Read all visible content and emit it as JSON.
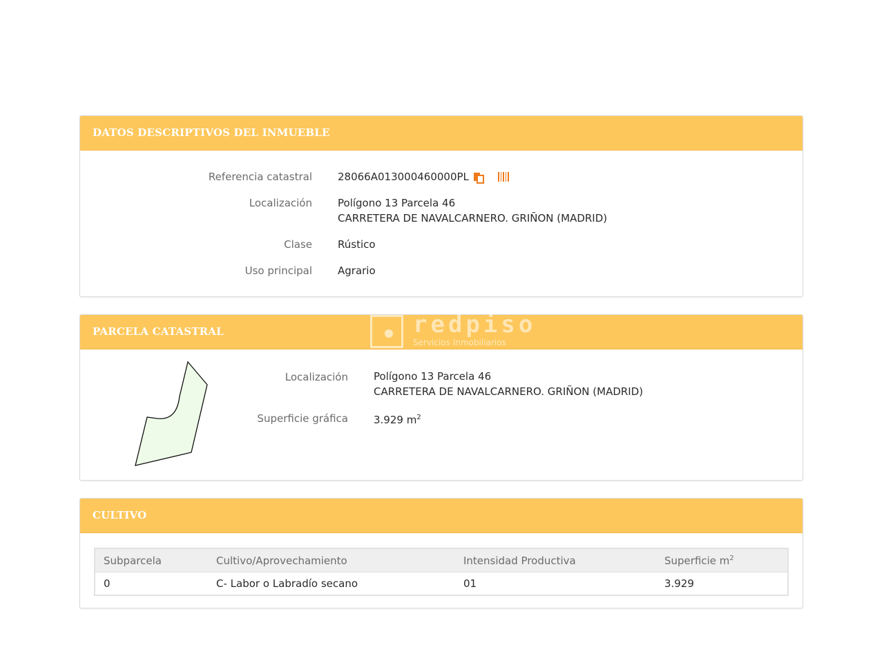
{
  "section1": {
    "title": "DATOS DESCRIPTIVOS DEL INMUEBLE",
    "ref_label": "Referencia catastral",
    "ref_value": "28066A013000460000PL",
    "loc_label": "Localización",
    "loc_line1": "Polígono 13 Parcela 46",
    "loc_line2": "CARRETERA DE NAVALCARNERO. GRIÑON (MADRID)",
    "clase_label": "Clase",
    "clase_value": "Rústico",
    "uso_label": "Uso principal",
    "uso_value": "Agrario"
  },
  "section2": {
    "title": "PARCELA CATASTRAL",
    "loc_label": "Localización",
    "loc_line1": "Polígono 13 Parcela 46",
    "loc_line2": "CARRETERA DE NAVALCARNERO. GRIÑON (MADRID)",
    "sup_label": "Superficie gráfica",
    "sup_value": "3.929 m",
    "sup_exp": "2"
  },
  "section3": {
    "title": "CULTIVO",
    "headers": {
      "subparcela": "Subparcela",
      "cultivo": "Cultivo/Aprovechamiento",
      "intensidad": "Intensidad Productiva",
      "superficie": "Superficie m",
      "superficie_exp": "2"
    },
    "rows": [
      {
        "subparcela": "0",
        "cultivo": "C- Labor o Labradío secano",
        "intensidad": "01",
        "superficie": "3.929"
      }
    ]
  },
  "watermark": {
    "title": "redpiso",
    "subtitle": "Servicios Inmobiliarios"
  },
  "colors": {
    "header_bg": "#fdc75b",
    "icon_accent": "#f07a1a",
    "parcel_fill": "#eefbe8"
  },
  "icons": [
    "copy-icon",
    "barcode-icon"
  ]
}
